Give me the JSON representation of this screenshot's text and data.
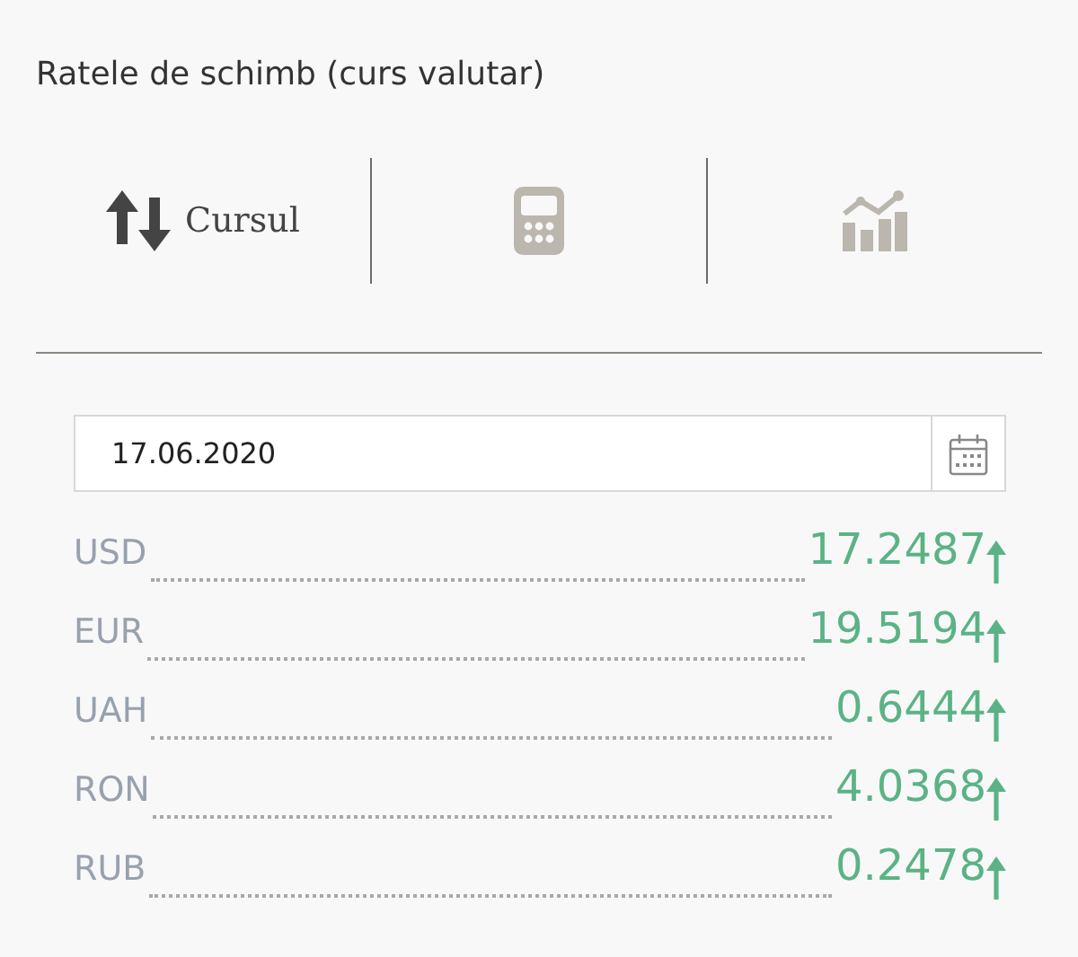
{
  "title": "Ratele de schimb (curs valutar)",
  "tabs": [
    {
      "kind": "rates",
      "label": "Cursul",
      "selected": true
    },
    {
      "kind": "converter",
      "selected": false
    },
    {
      "kind": "chart",
      "selected": false
    }
  ],
  "date_field": {
    "value": "17.06.2020"
  },
  "rates": [
    {
      "currency": "USD",
      "value": "17.2487",
      "rising": true
    },
    {
      "currency": "EUR",
      "value": "19.5194",
      "rising": true
    },
    {
      "currency": "UAH",
      "value": "0.6444",
      "rising": true
    },
    {
      "currency": "RON",
      "value": "4.0368",
      "rising": true
    },
    {
      "currency": "RUB",
      "value": "0.2478",
      "rising": true
    }
  ]
}
